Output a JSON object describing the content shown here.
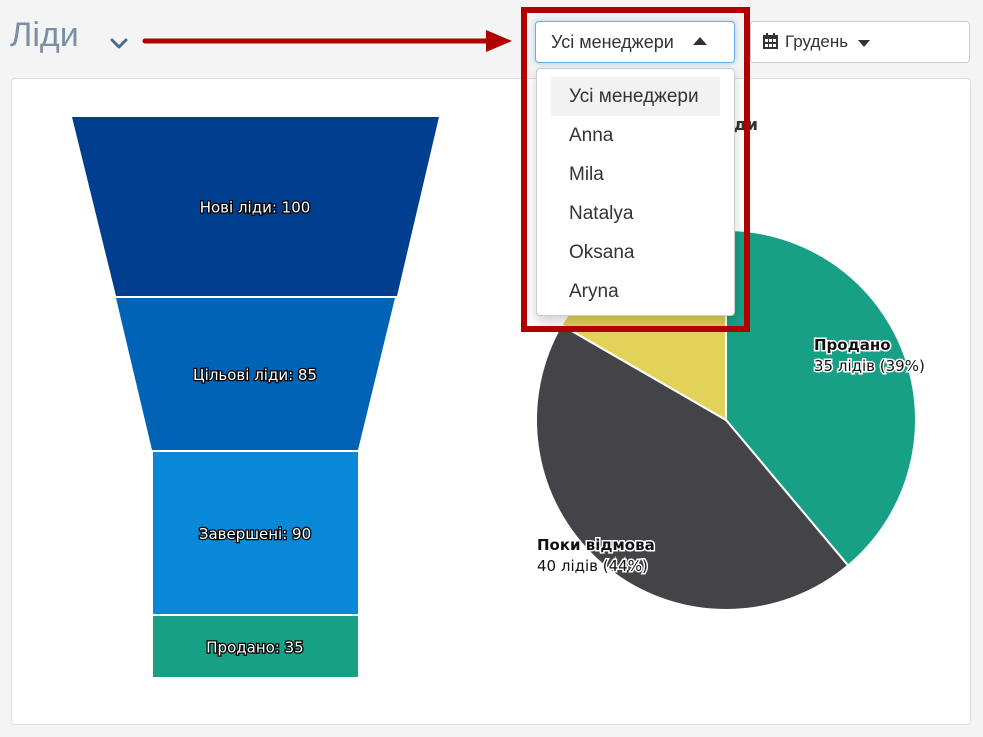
{
  "page": {
    "title": "Ліди"
  },
  "managers": {
    "selected": "Усі менеджери",
    "options": [
      "Усі менеджери",
      "Anna",
      "Mila",
      "Natalya",
      "Oksana",
      "Aryna"
    ]
  },
  "month": {
    "selected": "Грудень"
  },
  "chart_data": [
    {
      "type": "funnel",
      "stages": [
        {
          "label": "Нові ліди: 100",
          "value": 100,
          "color": "#003f8f"
        },
        {
          "label": "Цільові ліди: 85",
          "value": 85,
          "color": "#0063b5"
        },
        {
          "label": "Завершені: 90",
          "value": 90,
          "color": "#0a88d8"
        },
        {
          "label": "Продано: 35",
          "value": 35,
          "color": "#17a085"
        }
      ]
    },
    {
      "type": "pie",
      "title": "н ліди",
      "slices": [
        {
          "name": "Продано",
          "detail": "35 лідів (39%)",
          "value": 35,
          "color": "#17a085"
        },
        {
          "name": "Поки відмова",
          "detail": "40 лідів (44%)",
          "value": 40,
          "color": "#444448"
        },
        {
          "name": "",
          "detail": "",
          "value": 15,
          "color": "#e3d259"
        }
      ]
    }
  ]
}
